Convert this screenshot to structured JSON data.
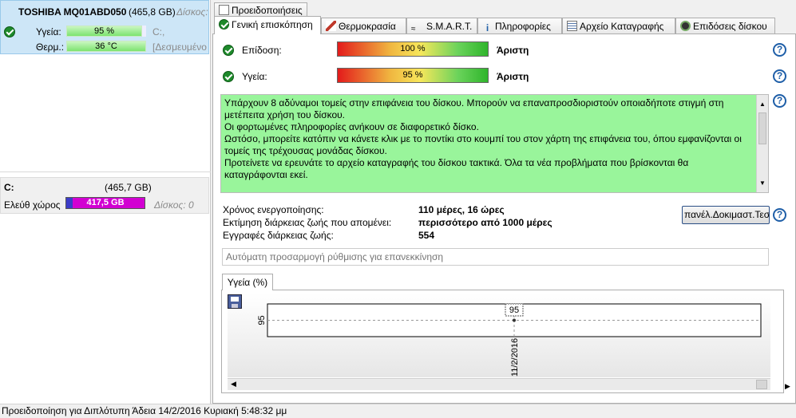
{
  "drive": {
    "name": "TOSHIBA MQ01ABD050",
    "size": "(465,8 GB)",
    "disk_label": "Δίσκος:",
    "health_label": "Υγεία:",
    "health_value": "95 %",
    "health_pct": 95,
    "temp_label": "Θερμ.:",
    "temp_value": "36 °C",
    "partition_letter": "C:,",
    "reserved": "[Δεσμευμένο"
  },
  "partition": {
    "letter": "C:",
    "size": "(465,7 GB)",
    "free_label": "Ελεύθ χώρος",
    "free_value": "417,5 GB",
    "disk": "Δίσκος: 0"
  },
  "top_tab": "Προειδοποιήσεις",
  "tabs": [
    {
      "label": "Γενική επισκόπηση",
      "icon": "ok-icon"
    },
    {
      "label": "Θερμοκρασία",
      "icon": "thermometer-icon"
    },
    {
      "label": "S.M.A.R.T.",
      "icon": "smart-icon"
    },
    {
      "label": "Πληροφορίες",
      "icon": "info-icon"
    },
    {
      "label": "Αρχείο Καταγραφής",
      "icon": "log-icon"
    },
    {
      "label": "Επιδόσεις δίσκου",
      "icon": "gauge-icon"
    }
  ],
  "overview": {
    "performance_label": "Επίδοση:",
    "performance_value": "100 %",
    "performance_pct": 100,
    "performance_rating": "Άριστη",
    "health_label": "Υγεία:",
    "health_value": "95 %",
    "health_pct": 95,
    "health_rating": "Άριστη",
    "message_lines": [
      "Υπάρχουν 8 αδύναμοι τομείς στην επιφάνεια του δίσκου. Μπορούν να επαναπροσδιοριστούν οποιαδήποτε στιγμή στη",
      "μετέπειτα χρήση του δίσκου.",
      "Οι φορτωμένες πληροφορίες ανήκουν σε διαφορετικό δίσκο.",
      "Ωστόσο, μπορείτε κατόπιν να κάνετε κλικ με το ποντίκι στο κουμπί του  στον  χάρτη της επιφάνεια του, όπου εμφανίζονται οι",
      "τομείς της τρέχουσας μονάδας δίσκου.",
      "Προτείνετε να ερευνάτε το αρχείο καταγραφής του δίσκου τακτικά. Όλα τα νέα προβλήματα που βρίσκονται θα",
      "καταγράφονται εκεί."
    ],
    "uptime_label": "Χρόνος ενεργοποίησης:",
    "uptime_value": "110 μέρες, 16 ώρες",
    "lifetime_label": "Εκτίμηση διάρκειας ζωής που απομένει:",
    "lifetime_value": "περισσότερο από 1000 μέρες",
    "records_label": "Εγγραφές διάρκειας ζωής:",
    "records_value": "554",
    "button_label": "πανέλ.Δοκιμαστ.Τεστ",
    "input_placeholder": "Αυτόματη προσαρμογή ρύθμισης για επανεκκίνηση"
  },
  "chart_tab": "Υγεία (%)",
  "chart_data": {
    "type": "line",
    "x": [
      "11/2/2016"
    ],
    "y": [
      95
    ],
    "series": [
      {
        "values": [
          95
        ]
      }
    ],
    "title": "",
    "xlabel": "",
    "ylabel": "",
    "point_labels": [
      "95"
    ],
    "ytick_labels": [
      "95"
    ],
    "grid": true
  },
  "status": "Προειδοποίηση για Διπλότυπη  Άδεια 14/2/2016 Κυριακή 5:48:32 μμ",
  "colors": {
    "selected_drive_bg": "#cde6f7",
    "message_bg": "#99f59b",
    "health_bar": "#7de36f",
    "free_space_bar": "#d200d2"
  }
}
